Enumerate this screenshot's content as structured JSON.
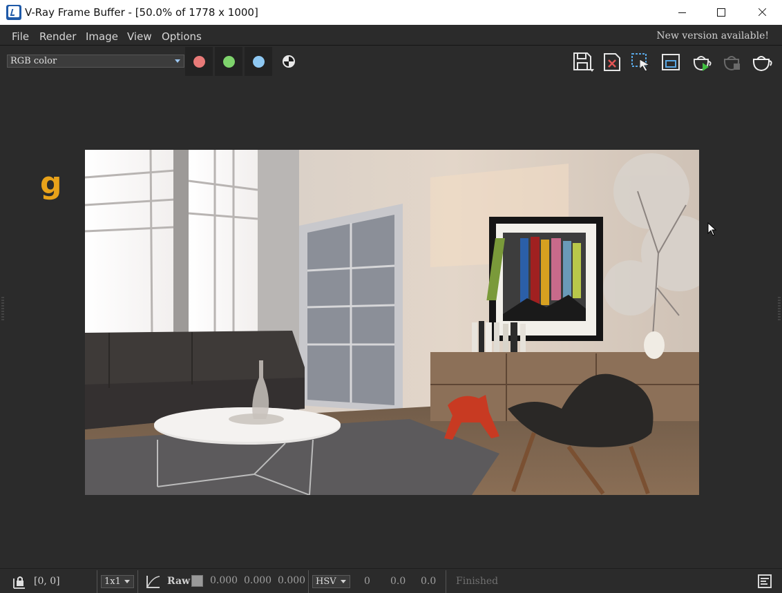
{
  "window": {
    "title": "V-Ray Frame Buffer - [50.0% of 1778 x 1000]"
  },
  "menu": {
    "items": [
      "File",
      "Render",
      "Image",
      "View",
      "Options"
    ],
    "notice": "New version available!"
  },
  "toolbar": {
    "channel": "RGB color",
    "channel_buttons": [
      {
        "name": "red-channel",
        "color": "#e87a78"
      },
      {
        "name": "green-channel",
        "color": "#7ed36c"
      },
      {
        "name": "blue-channel",
        "color": "#8ec8f2"
      }
    ],
    "icons": [
      "save-icon",
      "clear-image-icon",
      "region-render-icon",
      "link-to-viewport-icon",
      "render-interactive-icon",
      "stop-render-icon",
      "render-icon"
    ]
  },
  "render_view": {
    "logo_text": "g"
  },
  "statusbar": {
    "coords": "[0, 0]",
    "sample_size": "1x1",
    "raw_label": "Raw",
    "raw_values": [
      "0.000",
      "0.000",
      "0.000"
    ],
    "color_mode": "HSV",
    "hsv_values": [
      "0",
      "0.0",
      "0.0"
    ],
    "status": "Finished"
  },
  "colors": {
    "bg": "#2b2b2b",
    "logo": "#e8a21a",
    "accent_icon": "#5aa9e6"
  }
}
